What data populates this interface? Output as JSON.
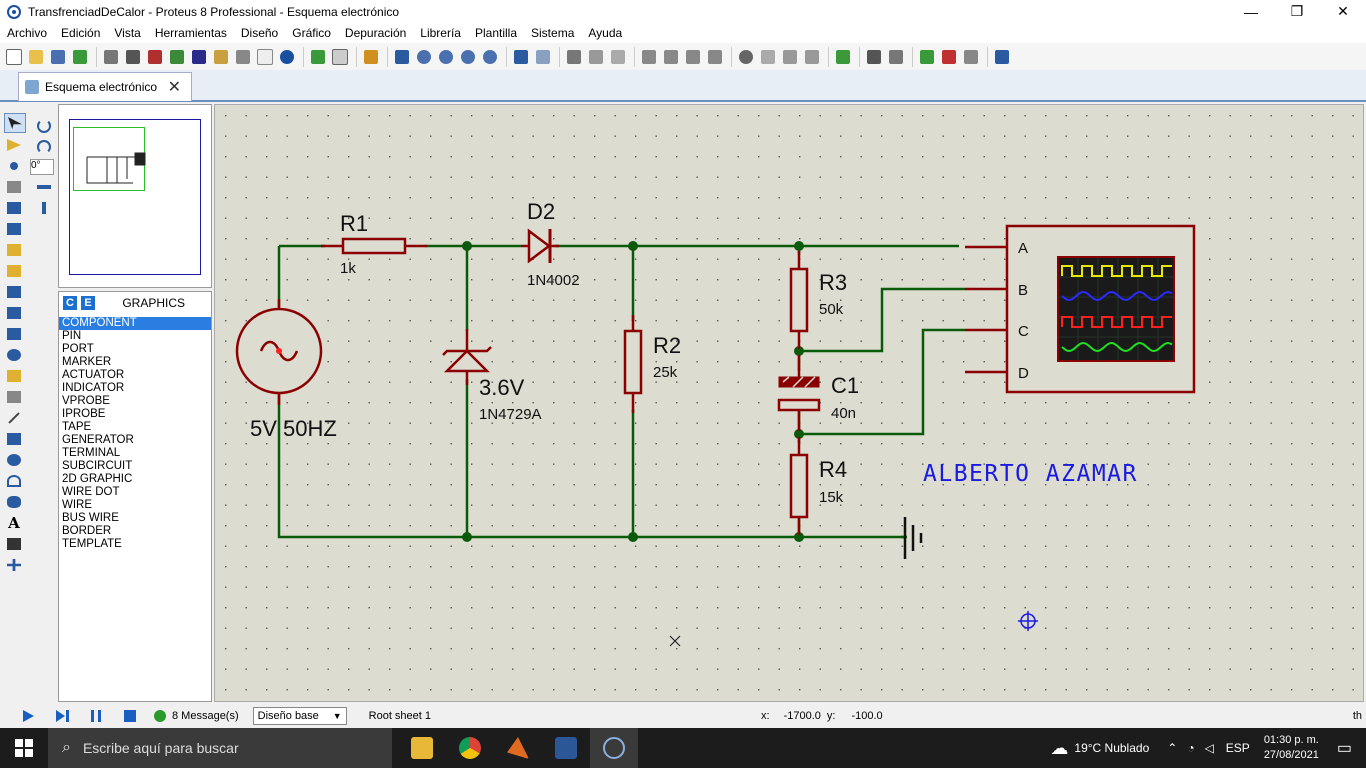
{
  "window": {
    "title": "TransfrenciadDeCalor - Proteus 8 Professional - Esquema electrónico",
    "minimize_glyph": "—",
    "restore_glyph": "❐",
    "close_glyph": "✕"
  },
  "menu": [
    "Archivo",
    "Edición",
    "Vista",
    "Herramientas",
    "Diseño",
    "Gráfico",
    "Depuración",
    "Librería",
    "Plantilla",
    "Sistema",
    "Ayuda"
  ],
  "tab": {
    "label": "Esquema electrónico",
    "close": "✕"
  },
  "rotation": {
    "value": "0°"
  },
  "picker": {
    "badge_c": "C",
    "badge_e": "E",
    "title": "GRAPHICS",
    "items": [
      "COMPONENT",
      "PIN",
      "PORT",
      "MARKER",
      "ACTUATOR",
      "INDICATOR",
      "VPROBE",
      "IPROBE",
      "TAPE",
      "GENERATOR",
      "TERMINAL",
      "SUBCIRCUIT",
      "2D GRAPHIC",
      "WIRE DOT",
      "WIRE",
      "BUS WIRE",
      "BORDER",
      "TEMPLATE"
    ],
    "selected": "COMPONENT"
  },
  "schematic": {
    "r1": {
      "ref": "R1",
      "value": "1k"
    },
    "d2": {
      "ref": "D2",
      "value": "1N4002"
    },
    "zener": {
      "ref": "3.6V",
      "value": "1N4729A"
    },
    "r2": {
      "ref": "R2",
      "value": "25k"
    },
    "r3": {
      "ref": "R3",
      "value": "50k"
    },
    "c1": {
      "ref": "C1",
      "value": "40n"
    },
    "r4": {
      "ref": "R4",
      "value": "15k"
    },
    "source": {
      "label": "5V 50HZ"
    },
    "scope_channels": [
      "A",
      "B",
      "C",
      "D"
    ],
    "author": "ALBERTO AZAMAR",
    "colors": {
      "wire": "#0b5a0b",
      "component": "#8b0000",
      "text": "#111111",
      "author": "#1a1ae0",
      "background": "#dcdcd0"
    },
    "trace_colors": [
      "#e6e600",
      "#2a2aff",
      "#ff2020",
      "#20e020"
    ]
  },
  "status": {
    "messages": "8 Message(s)",
    "layer": "Diseño base",
    "sheet": "Root sheet 1",
    "x_label": "x:",
    "x_value": "-1700.0",
    "y_label": "y:",
    "y_value": "-100.0",
    "trailing": "th"
  },
  "taskbar": {
    "search_placeholder": "Escribe aquí para buscar",
    "weather": "19°C  Nublado",
    "lang": "ESP",
    "time": "01:30 p. m.",
    "date": "27/08/2021"
  }
}
